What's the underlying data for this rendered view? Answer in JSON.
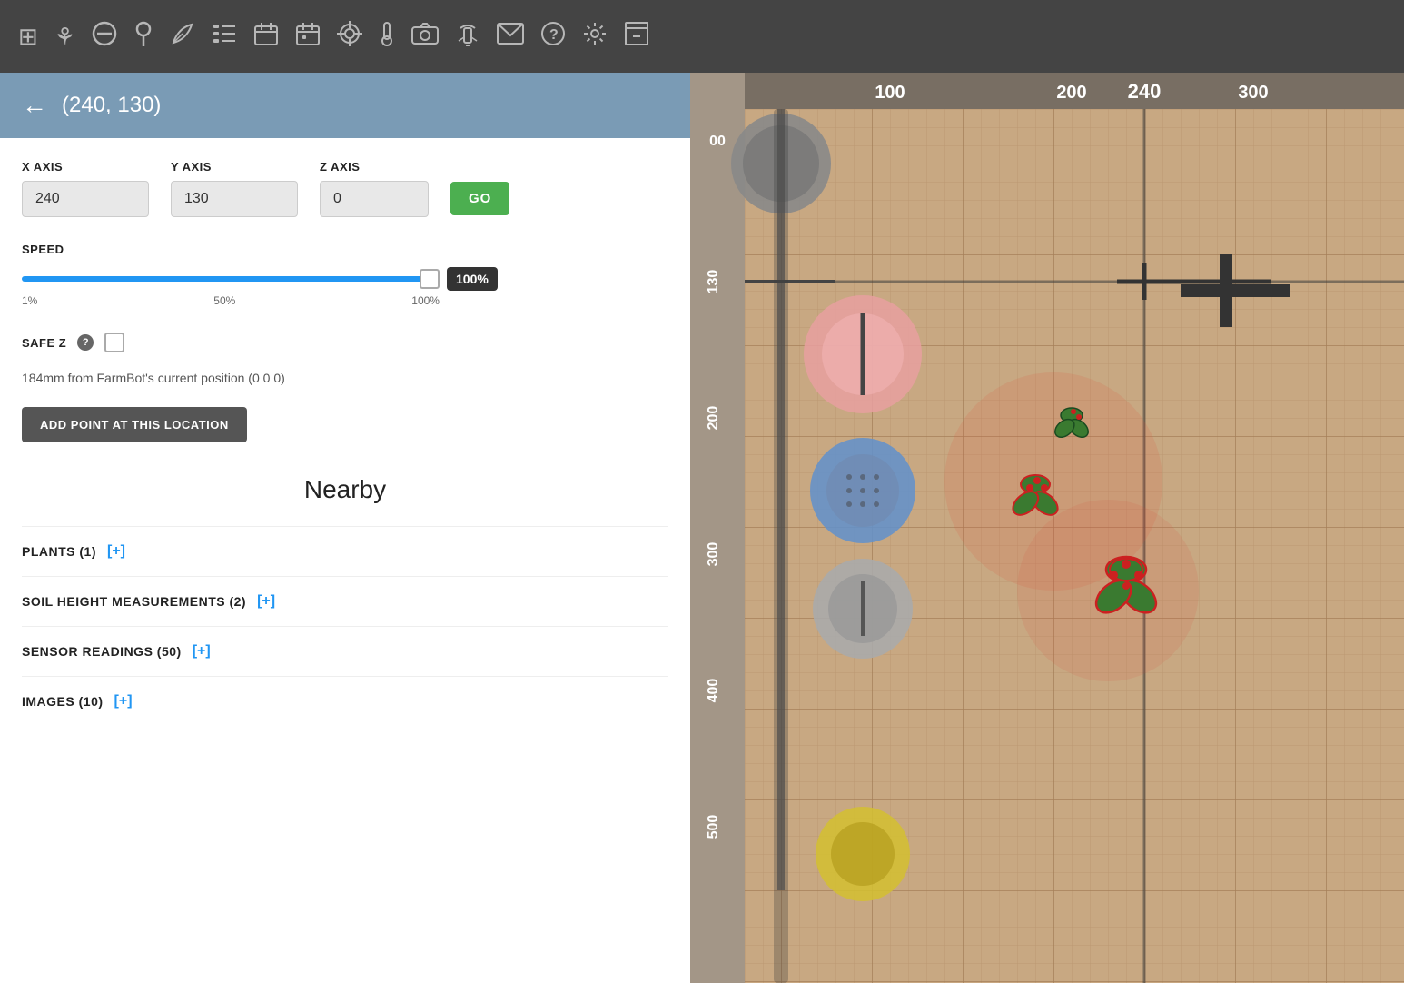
{
  "toolbar": {
    "icons": [
      {
        "name": "grid-icon",
        "symbol": "⊞"
      },
      {
        "name": "plant-icon",
        "symbol": "🌿"
      },
      {
        "name": "no-entry-icon",
        "symbol": "⊗"
      },
      {
        "name": "pin-icon",
        "symbol": "⚲"
      },
      {
        "name": "leaf-icon",
        "symbol": "🍃"
      },
      {
        "name": "list-numbered-icon",
        "symbol": "≡"
      },
      {
        "name": "calendar-icon",
        "symbol": "📅"
      },
      {
        "name": "calendar-alt-icon",
        "symbol": "📆"
      },
      {
        "name": "target-icon",
        "symbol": "⊕"
      },
      {
        "name": "thermometer-icon",
        "symbol": "🌡"
      },
      {
        "name": "camera-icon",
        "symbol": "📷"
      },
      {
        "name": "sprinkler-icon",
        "symbol": "💧"
      },
      {
        "name": "mail-icon",
        "symbol": "✉"
      },
      {
        "name": "help-icon",
        "symbol": "?"
      },
      {
        "name": "settings-icon",
        "symbol": "⚙"
      },
      {
        "name": "archive-icon",
        "symbol": "🗃"
      }
    ]
  },
  "header": {
    "back_label": "←",
    "title": "(240, 130)"
  },
  "axes": {
    "x_label": "X AXIS",
    "y_label": "Y AXIS",
    "z_label": "Z AXIS",
    "x_value": "240",
    "y_value": "130",
    "z_value": "0",
    "go_label": "GO"
  },
  "speed": {
    "label": "SPEED",
    "value": 100,
    "min_label": "1%",
    "mid_label": "50%",
    "max_label": "100%",
    "badge_label": "100%"
  },
  "safe_z": {
    "label": "SAFE Z",
    "checked": false
  },
  "distance_info": "184mm from FarmBot's current position (0 0 0)",
  "add_point_button": "ADD POINT AT THIS LOCATION",
  "nearby": {
    "title": "Nearby",
    "items": [
      {
        "label": "PLANTS (1)",
        "add_label": "[+]",
        "name": "plants-nearby"
      },
      {
        "label": "SOIL HEIGHT MEASUREMENTS (2)",
        "add_label": "[+]",
        "name": "soil-height-nearby"
      },
      {
        "label": "SENSOR READINGS (50)",
        "add_label": "[+]",
        "name": "sensor-readings-nearby"
      },
      {
        "label": "IMAGES (10)",
        "add_label": "[+]",
        "name": "images-nearby"
      }
    ]
  },
  "map": {
    "x_labels": [
      "100",
      "200",
      "240",
      "300"
    ],
    "y_labels": [
      "00",
      "130",
      "200",
      "300",
      "400",
      "500"
    ],
    "x_highlight": "240"
  }
}
